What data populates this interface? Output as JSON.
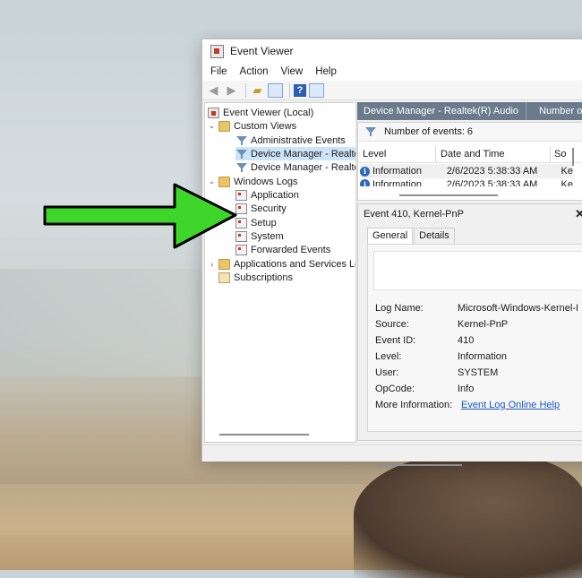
{
  "window": {
    "title": "Event Viewer"
  },
  "menu": [
    "File",
    "Action",
    "View",
    "Help"
  ],
  "toolbar": {
    "icons": [
      "back-arrow-icon",
      "forward-arrow-icon",
      "up-folder-icon",
      "show-hide-tree-icon",
      "help-icon",
      "show-hide-action-pane-icon"
    ]
  },
  "tree": {
    "root": "Event Viewer (Local)",
    "custom_views": "Custom Views",
    "custom_view_items": [
      "Administrative Events",
      "Device Manager - Realtek",
      "Device Manager - Realtek"
    ],
    "windows_logs": "Windows Logs",
    "windows_log_items": [
      "Application",
      "Security",
      "Setup",
      "System",
      "Forwarded Events"
    ],
    "apps_services": "Applications and Services Lo",
    "subscriptions": "Subscriptions"
  },
  "main": {
    "header_title": "Device Manager - Realtek(R) Audio",
    "header_count_label": "Number of ...",
    "events_count": "Number of events: 6",
    "columns": [
      "Level",
      "Date and Time",
      "So"
    ],
    "rows": [
      {
        "level": "Information",
        "date": "2/6/2023 5:38:33 AM",
        "source": "Ke"
      },
      {
        "level": "Information",
        "date": "2/6/2023 5:38:33 AM",
        "source": "Ke"
      }
    ]
  },
  "detail": {
    "title": "Event 410, Kernel-PnP",
    "close": "✕",
    "tabs": [
      "General",
      "Details"
    ],
    "properties": [
      {
        "label": "Log Name:",
        "value": "Microsoft-Windows-Kernel-I"
      },
      {
        "label": "Source:",
        "value": "Kernel-PnP"
      },
      {
        "label": "Event ID:",
        "value": "410"
      },
      {
        "label": "Level:",
        "value": "Information"
      },
      {
        "label": "User:",
        "value": "SYSTEM"
      },
      {
        "label": "OpCode:",
        "value": "Info"
      }
    ],
    "more_info_label": "More Information:",
    "more_info_link": "Event Log Online Help"
  },
  "colors": {
    "arrow_fill": "#3ed62a",
    "header_bar": "#6b7b8c",
    "selection": "#cce4f7",
    "link": "#1a56c4"
  }
}
